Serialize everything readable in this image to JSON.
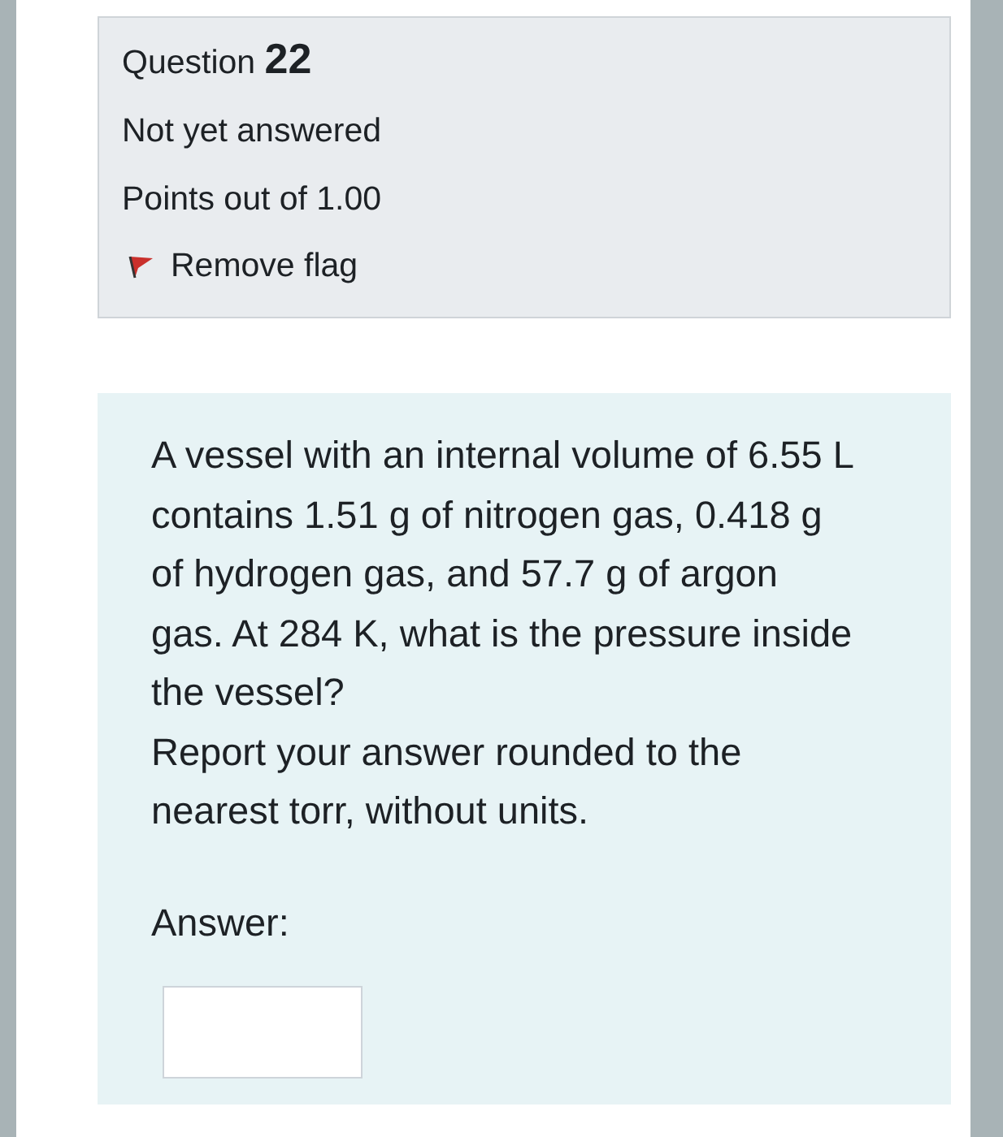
{
  "info": {
    "label": "Question",
    "number": "22",
    "status": "Not yet answered",
    "points": "Points out of 1.00",
    "flag": {
      "label": "Remove flag",
      "flagged": true
    }
  },
  "prompt": [
    "A vessel with an internal volume of 6.55 L contains 1.51 g of nitrogen gas, 0.418 g of hydrogen gas, and 57.7 g of argon gas. At 284 K, what is the pressure inside the vessel?",
    "Report your answer rounded to the nearest torr, without units."
  ],
  "answer": {
    "label": "Answer:"
  }
}
